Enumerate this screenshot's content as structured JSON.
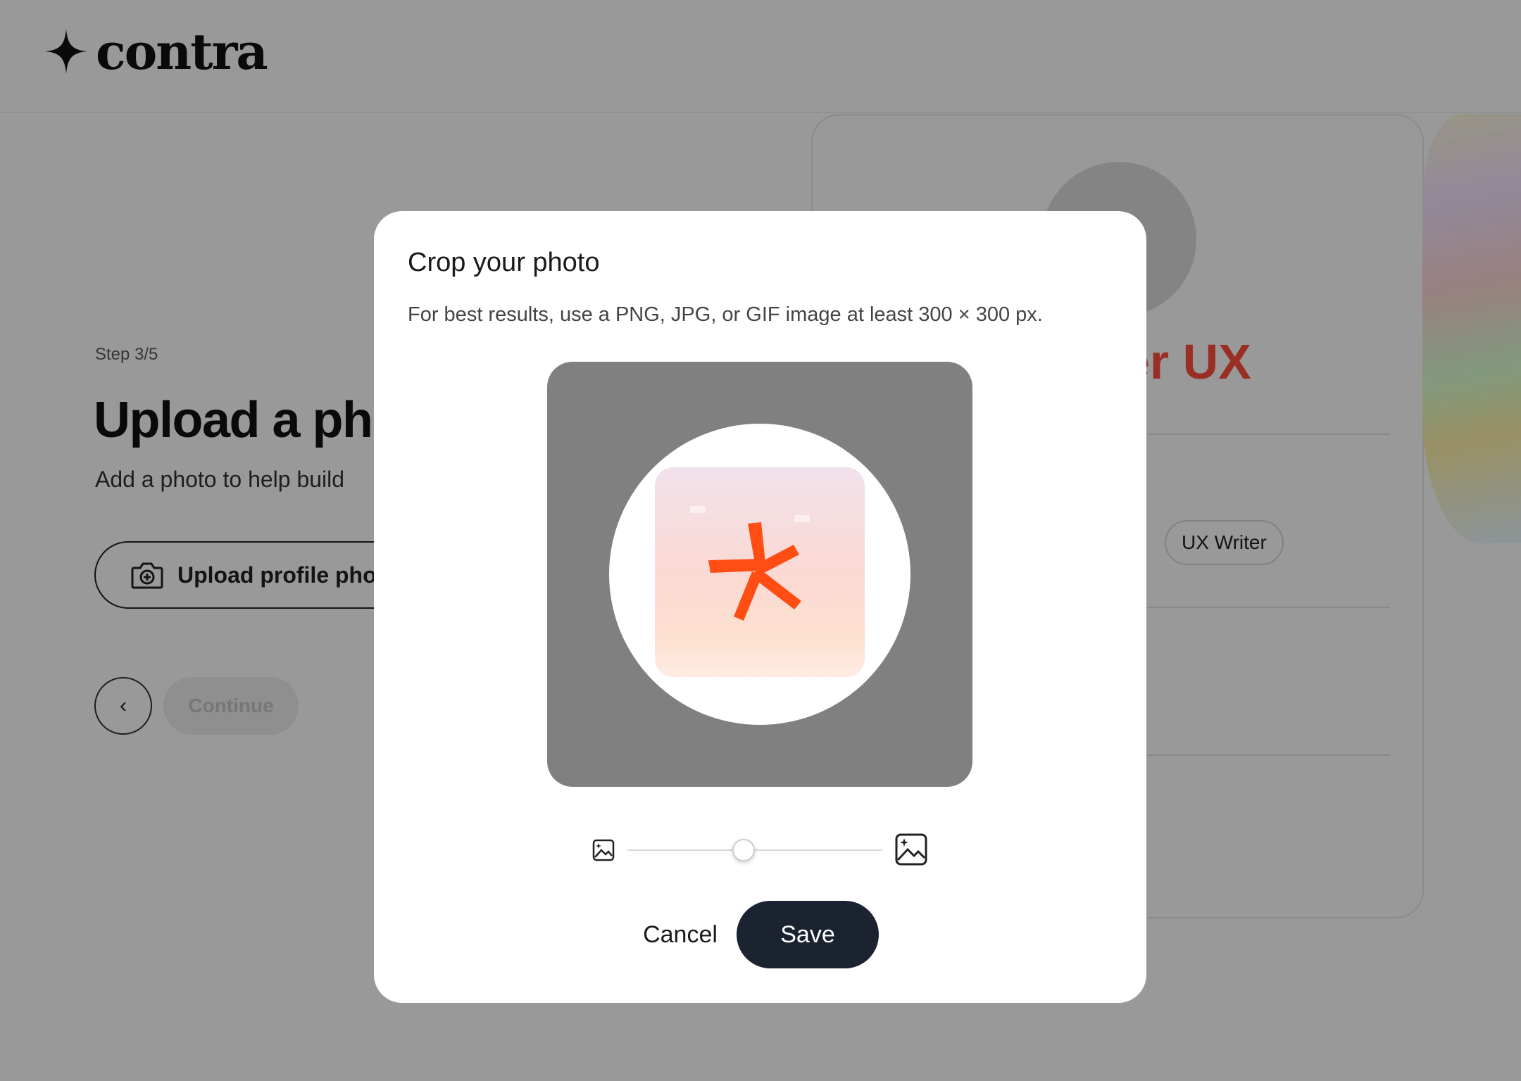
{
  "brand": {
    "name": "contra"
  },
  "page": {
    "step": "Step 3/5",
    "headline": "Upload a photo",
    "subline": "Add a photo to help build",
    "upload_label": "Upload profile photo",
    "back_label": "‹",
    "continue_label": "Continue"
  },
  "preview": {
    "title": "er UX",
    "chip": "UX Writer"
  },
  "modal": {
    "title": "Crop your photo",
    "subtitle": "For best results, use a PNG, JPG, or GIF image at least 300 × 300 px.",
    "zoom": {
      "value": 0.45,
      "min_icon": "image-small-icon",
      "max_icon": "image-large-icon"
    },
    "cancel_label": "Cancel",
    "save_label": "Save"
  },
  "colors": {
    "accent": "#ff4d14",
    "save_button": "#1b2230",
    "overlay": "rgba(0,0,0,0.4)"
  }
}
